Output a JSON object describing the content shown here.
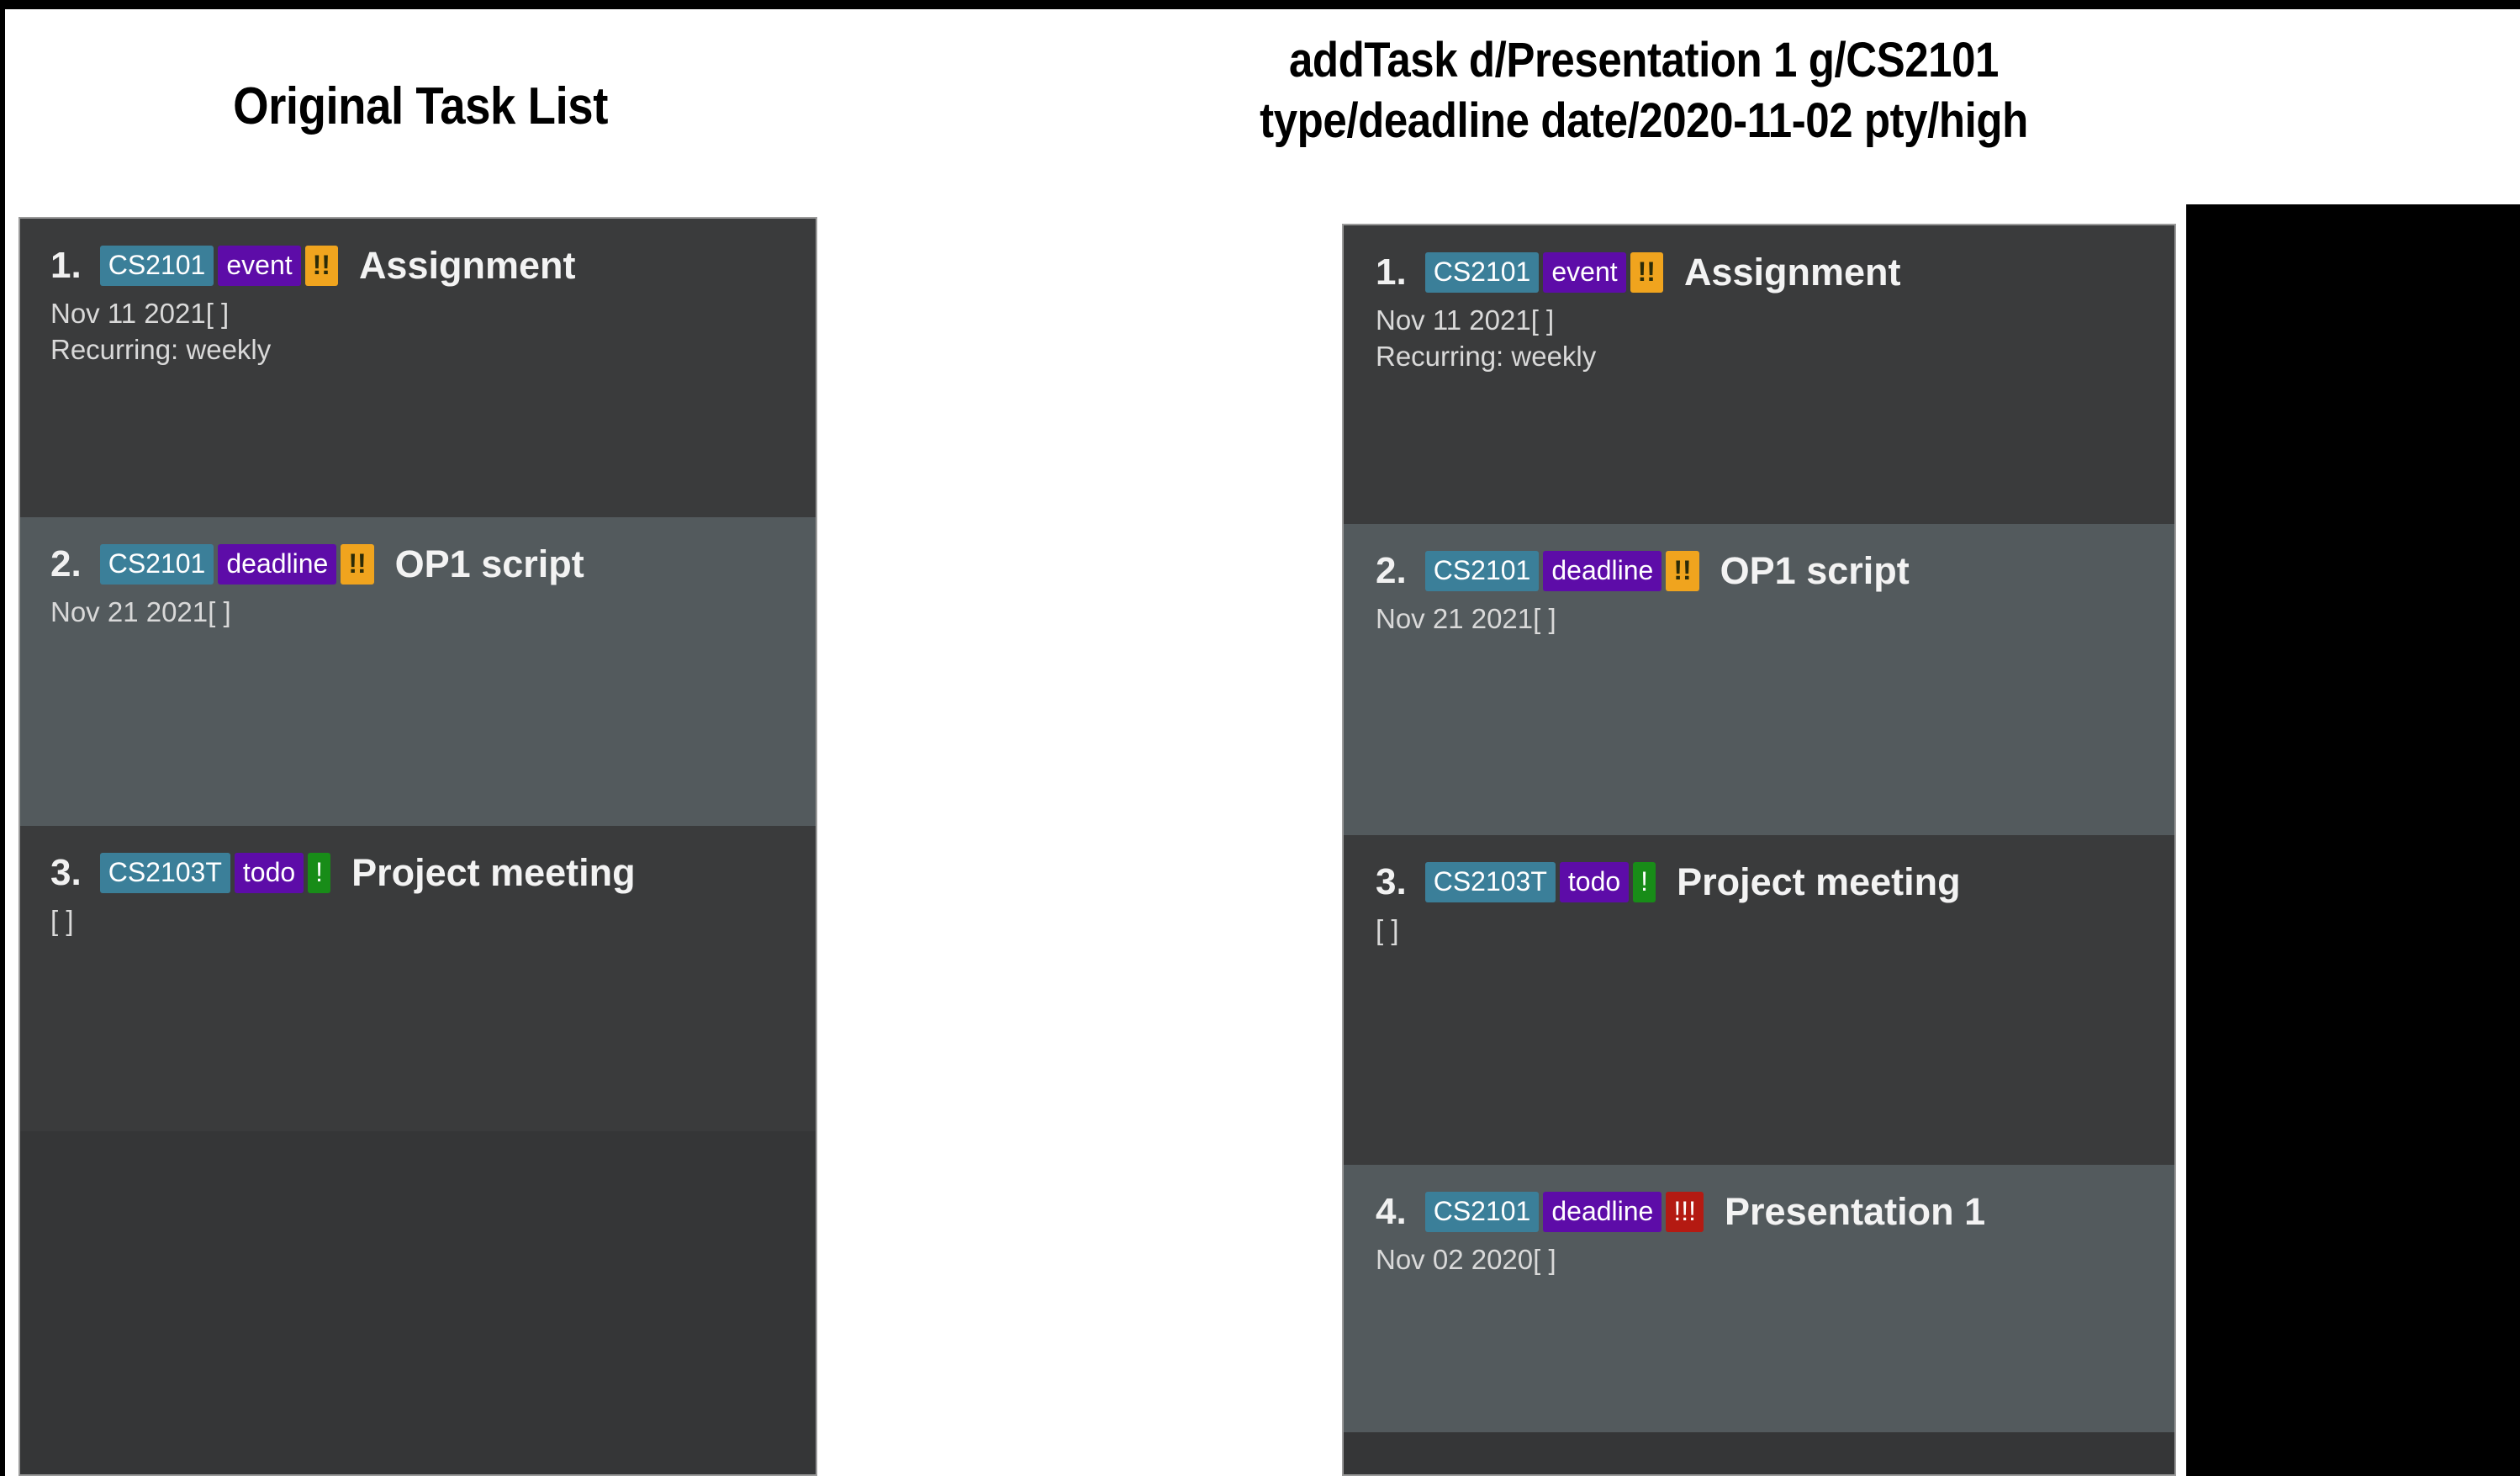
{
  "left_panel": {
    "heading": "Original Task List",
    "rows": [
      {
        "index": "1.",
        "group": "CS2101",
        "type": "event",
        "priority_mark": "!!",
        "priority_level": "medium",
        "title": "Assignment",
        "meta1": "Nov 11 2021[ ]",
        "meta2": "Recurring: weekly",
        "shade": "dark"
      },
      {
        "index": "2.",
        "group": "CS2101",
        "type": "deadline",
        "priority_mark": "!!",
        "priority_level": "medium",
        "title": "OP1 script",
        "meta1": "Nov 21 2021[ ]",
        "meta2": "",
        "shade": "light"
      },
      {
        "index": "3.",
        "group": "CS2103T",
        "type": "todo",
        "priority_mark": "!",
        "priority_level": "low",
        "title": "Project meeting",
        "meta1": "[ ]",
        "meta2": "",
        "shade": "dark"
      }
    ]
  },
  "right_panel": {
    "heading_line1": "addTask d/Presentation 1 g/CS2101",
    "heading_line2": "type/deadline date/2020-11-02 pty/high",
    "rows": [
      {
        "index": "1.",
        "group": "CS2101",
        "type": "event",
        "priority_mark": "!!",
        "priority_level": "medium",
        "title": "Assignment",
        "meta1": "Nov 11 2021[ ]",
        "meta2": "Recurring: weekly",
        "shade": "dark"
      },
      {
        "index": "2.",
        "group": "CS2101",
        "type": "deadline",
        "priority_mark": "!!",
        "priority_level": "medium",
        "title": "OP1 script",
        "meta1": "Nov 21 2021[ ]",
        "meta2": "",
        "shade": "light"
      },
      {
        "index": "3.",
        "group": "CS2103T",
        "type": "todo",
        "priority_mark": "!",
        "priority_level": "low",
        "title": "Project meeting",
        "meta1": "[ ]",
        "meta2": "",
        "shade": "dark"
      },
      {
        "index": "4.",
        "group": "CS2101",
        "type": "deadline",
        "priority_mark": "!!!",
        "priority_level": "high",
        "title": "Presentation 1",
        "meta1": "Nov 02 2020[ ]",
        "meta2": "",
        "shade": "light"
      }
    ]
  },
  "colors": {
    "panel_background": "#383838",
    "row_dark": "#3a3b3c",
    "row_light": "#535a5d",
    "group_tag": "#3b7f99",
    "type_tag": "#5d0ca8",
    "priority_high": "#b41a12",
    "priority_medium": "#f0a41e",
    "priority_low": "#188c18",
    "heading_text": "#000000",
    "page_background": "#ffffff",
    "block_fill": "#000000"
  }
}
